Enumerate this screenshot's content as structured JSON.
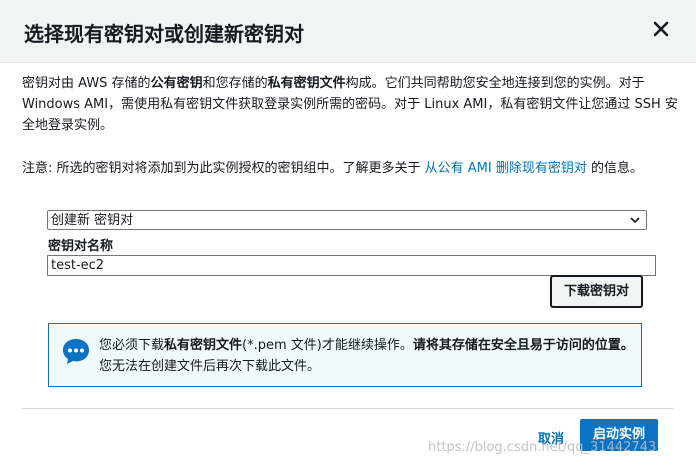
{
  "dialog": {
    "title": "选择现有密钥对或创建新密钥对",
    "close_icon": "close-icon"
  },
  "intro": {
    "t1": "密钥对由 AWS 存储的",
    "b1": "公有密钥",
    "t2": "和您存储的",
    "b2": "私有密钥文件",
    "t3": "构成。它们共同帮助您安全地连接到您的实例。对于 Windows AMI，需使用私有密钥文件获取登录实例所需的密码。对于 Linux AMI，私有密钥文件让您通过 SSH 安全地登录实例。"
  },
  "note": {
    "t1": "注意: 所选的密钥对将添加到为此实例授权的密钥组中。了解更多关于",
    "link": "从公有 AMI 删除现有密钥对",
    "t2": "的信息。"
  },
  "form": {
    "select_value": "创建新 密钥对",
    "name_label": "密钥对名称",
    "name_value": "test-ec2",
    "download_label": "下载密钥对"
  },
  "alert": {
    "icon": "chat-bubble-icon",
    "t1": "您必须下载",
    "b1": "私有密钥文件",
    "t2": "(*.pem 文件)才能继续操作。",
    "b2": "请将其存储在安全且易于访问的位置。",
    "t3": "您无法在创建文件后再次下载此文件。"
  },
  "footer": {
    "cancel_label": "取消",
    "launch_label": "启动实例"
  },
  "watermark": "https://blog.csdn.net/qq_31442743",
  "colors": {
    "accent": "#0073bb",
    "primary_button": "#0b73c4",
    "header_bg": "#f2f3f3",
    "alert_bg": "#f1faff"
  }
}
